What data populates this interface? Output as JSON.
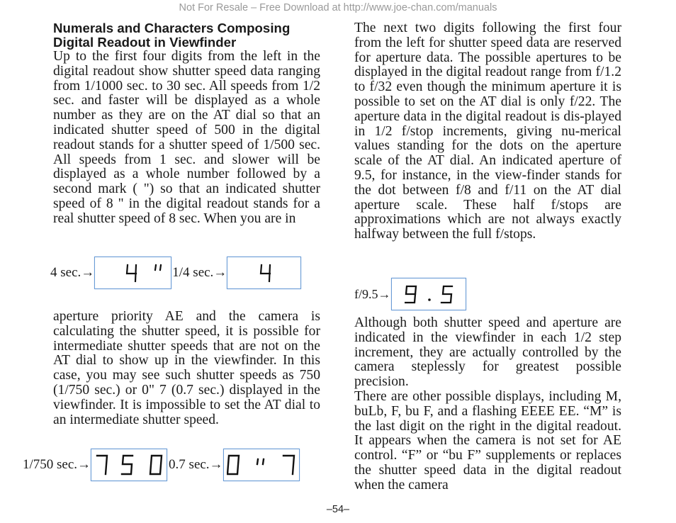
{
  "watermark": "Not For Resale – Free Download at http://www.joe-chan.com/manuals",
  "left_column": {
    "heading": "Numerals and Characters Composing Digital Readout in Viewfinder",
    "paragraph_1": "Up to the first four digits from the left in the digital readout show shutter speed data ranging from 1/1000 sec. to 30 sec. All speeds from 1/2 sec. and faster will be displayed as a whole number as they are on the AT dial so that an indicated shutter speed of 500 in the digital readout stands for a shutter speed of 1/500 sec. All speeds from 1 sec. and slower will be displayed as a whole number followed by a second mark ( \") so that an indicated shutter speed of 8 \" in the digital readout stands for a real shutter speed of 8 sec. When you are in",
    "paragraph_2": "aperture priority AE and the camera is calculating the shutter speed, it is possible for intermediate shutter speeds that are not on the AT dial to show up in the viewfinder. In this case, you may see such shutter speeds as 750 (1/750 sec.) or 0\" 7 (0.7 sec.) displayed in the viewfinder. It is impossible to set the AT dial to an intermediate shutter speed."
  },
  "right_column": {
    "paragraph_1": "The next two digits following the first four from the left for shutter speed data are reserved for aperture data. The possible apertures to be displayed in the digital readout range from f/1.2 to f/32 even though the minimum aperture it is possible to set on the AT dial is only f/22. The aperture data in the digital readout is dis-played in 1/2 f/stop increments, giving nu-merical values standing for the dots on the aperture scale of the AT dial. An indicated aperture of 9.5, for instance, in the view-finder stands for the dot between f/8 and f/11 on the AT dial aperture scale. These half f/stops are approximations which are not always exactly halfway between the full f/stops.",
    "paragraph_2": "Although both shutter speed and aperture are indicated in the viewfinder in each 1/2 step increment, they are actually controlled by the camera steplessly for greatest possible precision.",
    "paragraph_3": "There are other possible displays, including M, buLb, F, bu F, and a flashing EEEE EE. “M” is the last digit on the right in the digital readout. It appears when the camera is not set for AE control. “F” or “bu F” supplements or replaces the shutter speed data in the digital readout when the camera"
  },
  "figures": {
    "four_sec": {
      "label": "4 sec.→",
      "readout": "4 \""
    },
    "quarter_sec": {
      "label": "1/4 sec.→",
      "readout": "4"
    },
    "f95": {
      "label": "f/9.5→",
      "readout": "9 . 5"
    },
    "s750": {
      "label": "1/750 sec.→",
      "readout": "7 5 0"
    },
    "s07": {
      "label": "0.7 sec.→",
      "readout": "0 \" 7"
    }
  },
  "page_number": "–54–",
  "colors": {
    "lcd_border": "#6a9cd6",
    "watermark": "#9a9a9a"
  }
}
